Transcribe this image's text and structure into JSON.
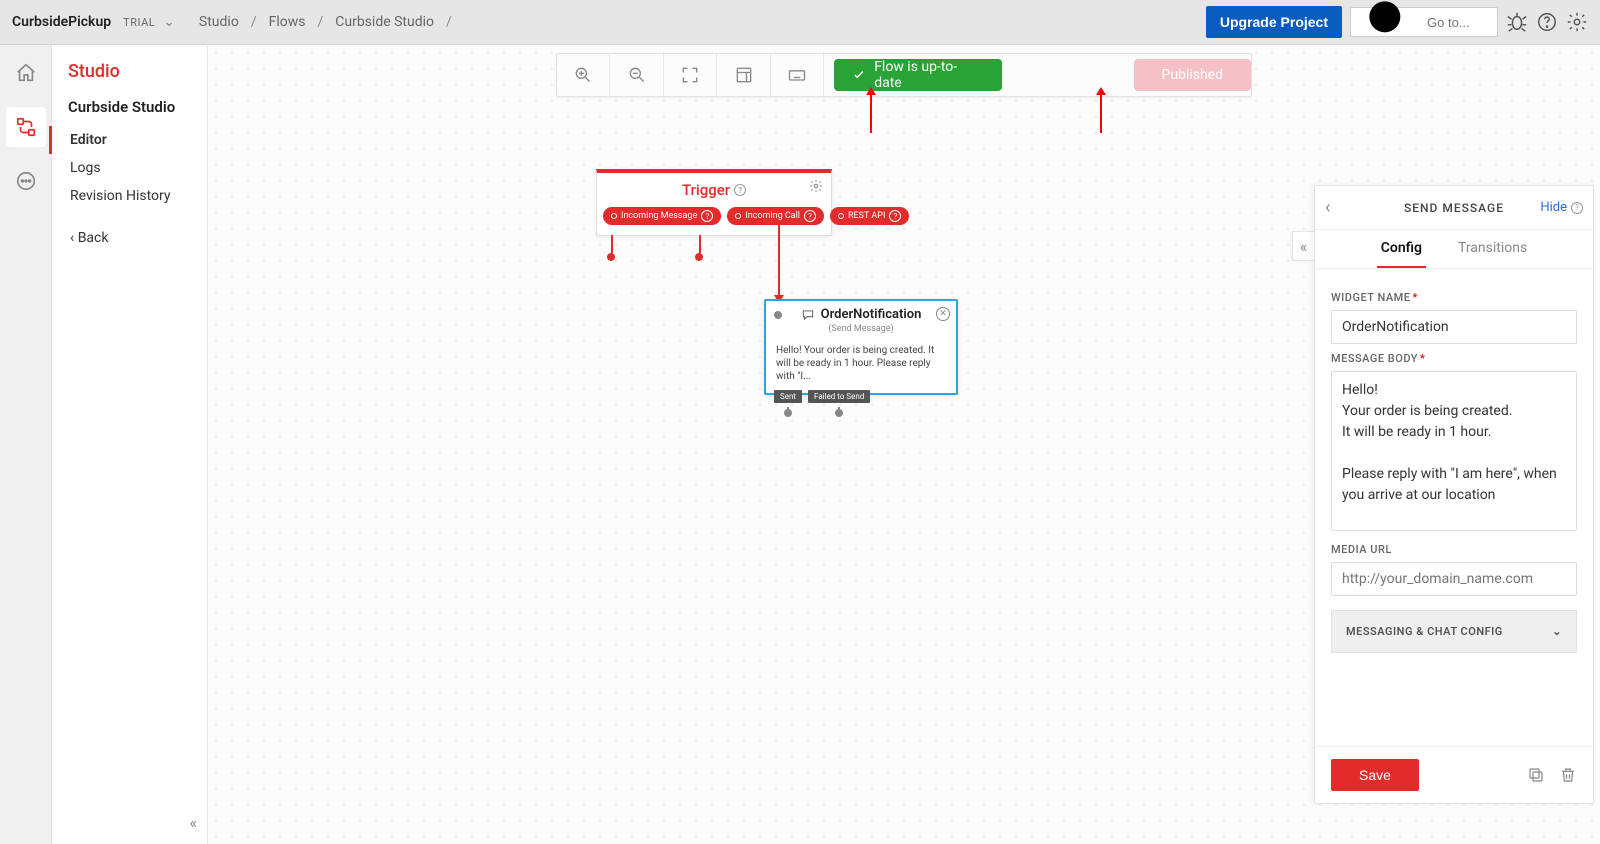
{
  "topbar": {
    "project": "CurbsidePickup",
    "trial": "TRIAL",
    "crumbs": [
      "Studio",
      "Flows",
      "Curbside Studio"
    ],
    "upgrade": "Upgrade Project",
    "search_placeholder": "Go to..."
  },
  "sidebar": {
    "title": "Studio",
    "sub": "Curbside Studio",
    "items": [
      "Editor",
      "Logs",
      "Revision History"
    ],
    "back": "Back"
  },
  "canvas": {
    "status_ok": "Flow is up-to-date",
    "status_pub": "Published",
    "trigger": {
      "title": "Trigger",
      "pills": [
        "Incoming Message",
        "Incoming Call",
        "REST API"
      ]
    },
    "msg_node": {
      "name": "OrderNotification",
      "subtitle": "(Send Message)",
      "preview": "Hello! Your order is being created. It will be ready in 1 hour. Please reply with \"I...",
      "ports": [
        "Sent",
        "Failed to Send"
      ]
    }
  },
  "rpanel": {
    "title": "SEND MESSAGE",
    "hide": "Hide",
    "tabs": [
      "Config",
      "Transitions"
    ],
    "widget_label": "WIDGET NAME",
    "widget_value": "OrderNotification",
    "body_label": "MESSAGE BODY",
    "body_value": "Hello!\nYour order is being created.\nIt will be ready in 1 hour.\n\nPlease reply with \"I am here\", when you arrive at our location",
    "media_label": "MEDIA URL",
    "media_placeholder": "http://your_domain_name.com",
    "accordion": "MESSAGING & CHAT CONFIG",
    "save": "Save"
  }
}
